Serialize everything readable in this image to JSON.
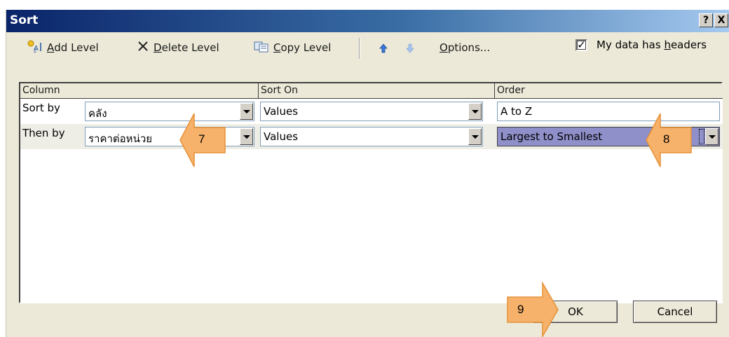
{
  "window": {
    "title": "Sort",
    "help_label": "?",
    "close_label": "X"
  },
  "toolbar": {
    "add_level": {
      "mnemonic": "A",
      "rest": "dd Level"
    },
    "delete_level": {
      "mnemonic": "D",
      "rest": "elete Level"
    },
    "copy_level": {
      "mnemonic": "C",
      "rest": "opy Level"
    },
    "options": {
      "mnemonic": "O",
      "rest": "ptions..."
    },
    "headers_checkbox": {
      "pre": "My data has ",
      "mnemonic": "h",
      "rest": "eaders",
      "checked": true,
      "check_mark": "✓"
    }
  },
  "grid": {
    "headers": {
      "column": "Column",
      "sort_on": "Sort On",
      "order": "Order"
    },
    "rows": [
      {
        "label": "Sort by",
        "column": "คลัง",
        "sort_on": "Values",
        "order": "A to Z"
      },
      {
        "label": "Then by",
        "column": "ราคาต่อหน่วย",
        "sort_on": "Values",
        "order": "Largest to Smallest"
      }
    ]
  },
  "buttons": {
    "ok": "OK",
    "cancel": "Cancel"
  },
  "callouts": {
    "step7": "7",
    "step8": "8",
    "step9": "9"
  },
  "colors": {
    "callout_fill": "#f6b26b",
    "callout_stroke": "#e69138",
    "selection": "#8f8fc9",
    "title_bar": "#0a246a"
  }
}
